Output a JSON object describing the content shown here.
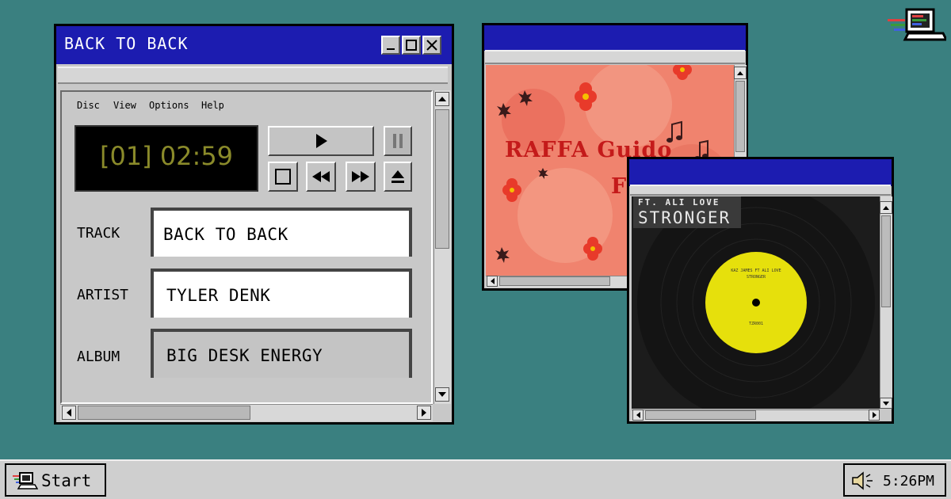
{
  "player": {
    "title": "BACK TO BACK",
    "menu": [
      "Disc",
      "View",
      "Options",
      "Help"
    ],
    "display": "[01] 02:59",
    "fields": {
      "track_label": "TRACK",
      "track_value": "BACK TO BACK",
      "artist_label": "ARTIST",
      "artist_value": "TYLER DENK",
      "album_label": "ALBUM",
      "album_value": "BIG DESK ENERGY"
    }
  },
  "art1": {
    "title_art": "RAFFA Guido",
    "title_art_2": "F"
  },
  "art2": {
    "feat": "FT. ALI LOVE",
    "song": "STRONGER",
    "label_line1": "KAZ JAMES FT ALI LOVE",
    "label_line2": "STRONGER",
    "label_code": "TZR001"
  },
  "taskbar": {
    "start_label": "Start",
    "clock": "5:26PM"
  },
  "colors": {
    "desktop": "#3a8080",
    "titlebar": "#1c1cb0",
    "lcd_text": "#8a8a2a",
    "art_salmon": "#f0836e",
    "record_label": "#e6e00c"
  }
}
